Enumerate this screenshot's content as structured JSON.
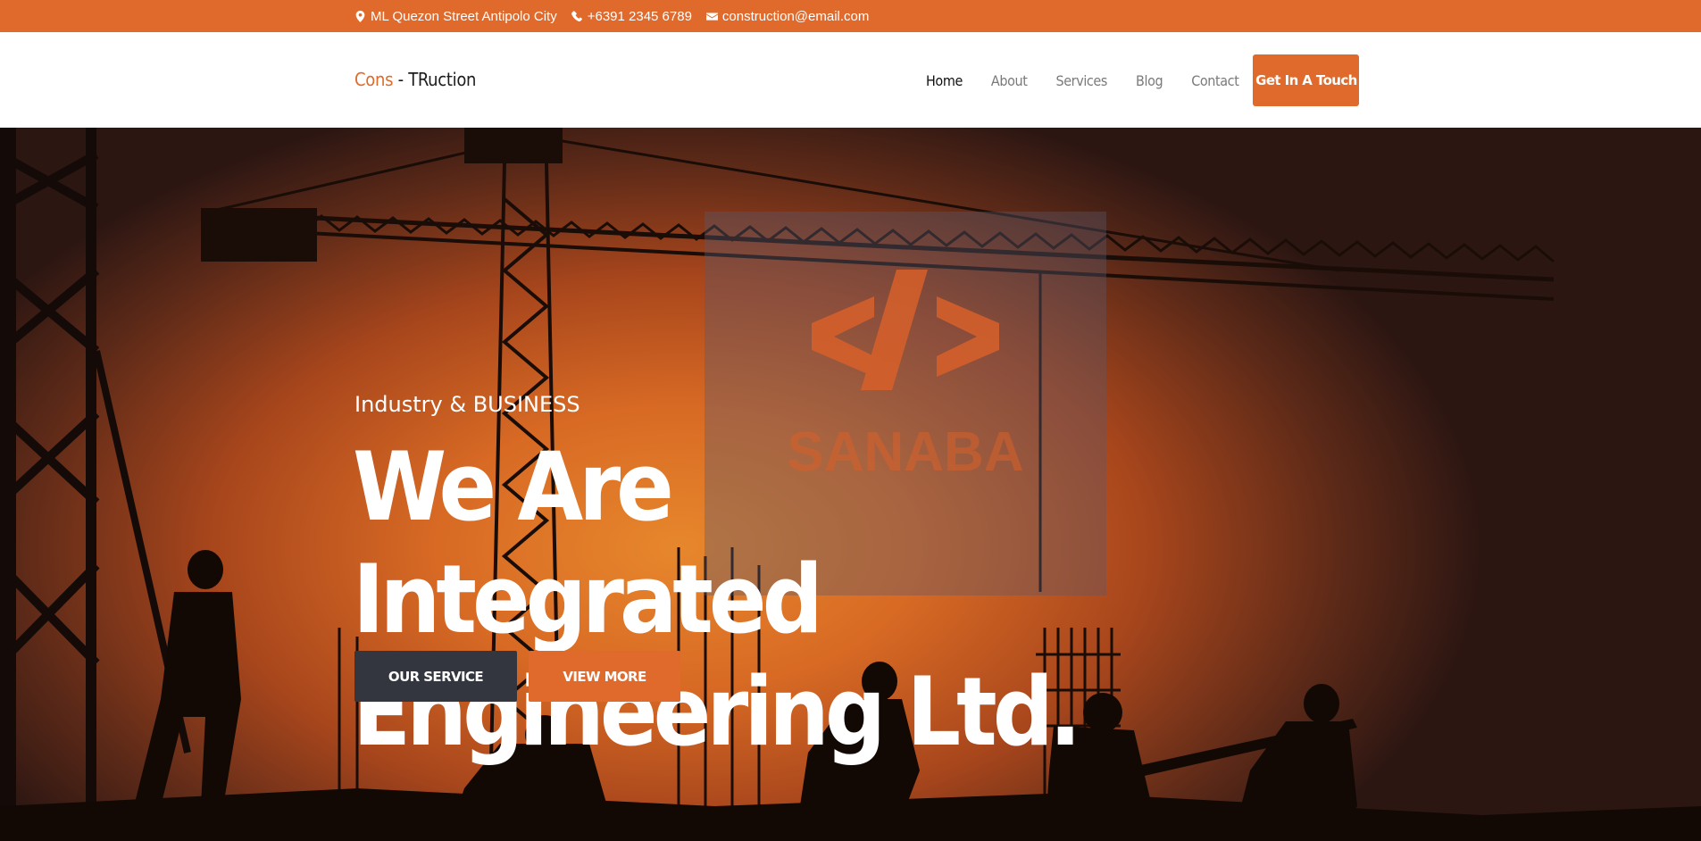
{
  "topbar": {
    "address": "ML Quezon Street Antipolo City",
    "phone": "+6391 2345 6789",
    "email": "construction@email.com",
    "background_color": "#e06a2c",
    "icons": [
      "map-marker-icon",
      "phone-icon",
      "envelope-icon"
    ]
  },
  "header": {
    "logo": {
      "part1": "Cons",
      "separator": " - ",
      "part2": "TRuction",
      "accent_color": "#e06a2c"
    },
    "nav": [
      {
        "label": "Home",
        "active": true
      },
      {
        "label": "About",
        "active": false
      },
      {
        "label": "Services",
        "active": false
      },
      {
        "label": "Blog",
        "active": false
      },
      {
        "label": "Contact",
        "active": false
      }
    ],
    "cta_label": "Get In A Touch"
  },
  "hero": {
    "subtitle": "Industry & BUSINESS",
    "title_line1": "We Are Integrated",
    "title_line2": "Engineering Ltd.",
    "primary_button": "OUR SERVICE",
    "secondary_button": "VIEW MORE",
    "background_image": "construction workers and tower crane silhouettes at orange sunset",
    "watermark_logo": "code-brackets-logo",
    "watermark_text": "SANABA"
  },
  "colors": {
    "accent": "#e06a2c",
    "dark_button": "#33363f",
    "text_on_hero": "#ffffff"
  }
}
